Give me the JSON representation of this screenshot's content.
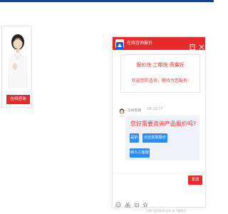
{
  "promo": {
    "button_label": "在线咨询"
  },
  "chat": {
    "title": "在线咨询报价",
    "notice_line1": "报价快 工期快 质量好",
    "notice_line2": "欢迎您的咨询，期待为您服务!",
    "agent_name": "在线客服",
    "agent_time": "06:20:17",
    "question": "您好需要咨询产品报价吗?",
    "quick_replies": [
      "是的",
      "点击获取报价",
      "转人工客服"
    ],
    "send_label": "发送",
    "footer": "53KF 提供软件支持  关于客服号",
    "accent_color": "#e52b2b",
    "button_color": "#2d8cf0",
    "icons": [
      "logo-icon",
      "minimize-icon",
      "close-icon",
      "emoji-icon",
      "scissors-icon",
      "file-icon",
      "star-icon"
    ]
  }
}
